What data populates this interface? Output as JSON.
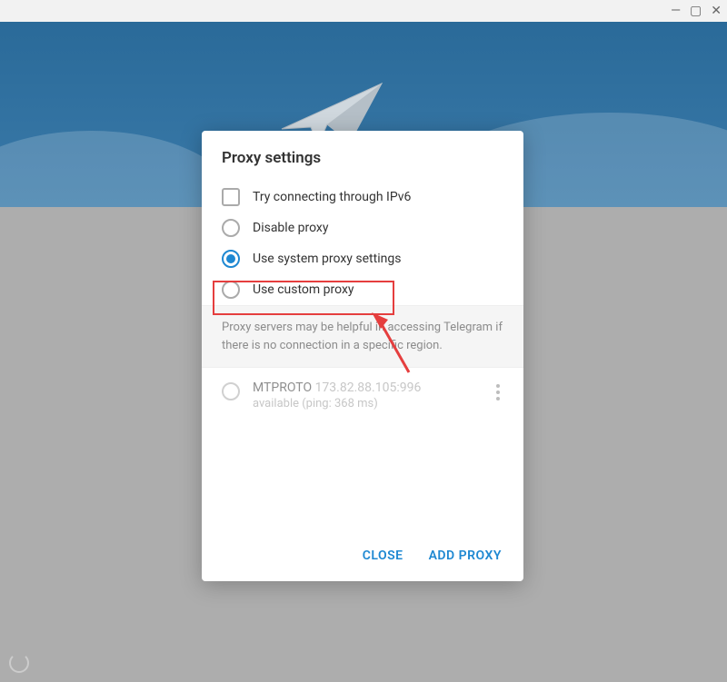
{
  "dialog": {
    "title": "Proxy settings",
    "options": {
      "ipv6": "Try connecting through IPv6",
      "disable": "Disable proxy",
      "system": "Use system proxy settings",
      "custom": "Use custom proxy"
    },
    "info": "Proxy servers may be helpful in accessing Telegram if there is no connection in a specific region.",
    "proxy": {
      "protocol": "MTPROTO",
      "address": "173.82.88.105:996",
      "status": "available (ping: 368 ms)"
    },
    "actions": {
      "close": "CLOSE",
      "add": "ADD PROXY"
    }
  }
}
